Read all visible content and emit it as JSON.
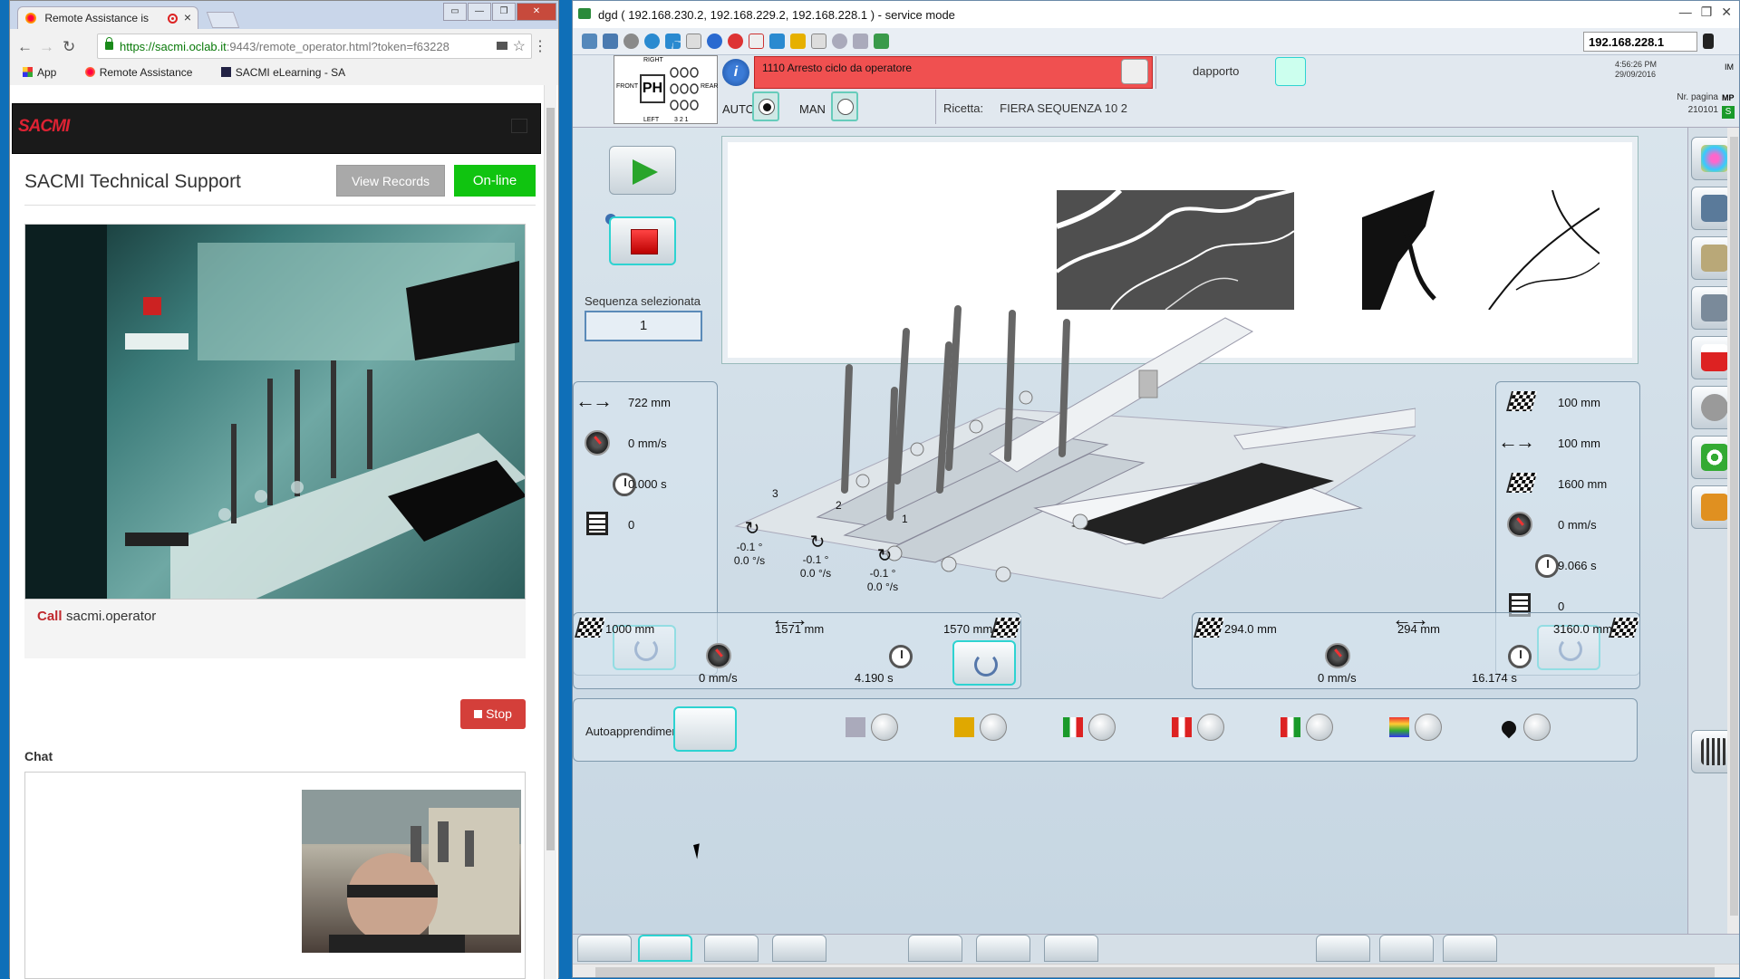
{
  "browser": {
    "tab_title": "Remote Assistance is",
    "url_host": "https://sacmi.oclab.it",
    "url_path": ":9443/remote_operator.html?token=f63228",
    "bookmarks": [
      "App",
      "Remote Assistance",
      "SACMI eLearning - SA"
    ]
  },
  "support": {
    "logo": "SACMI",
    "title": "SACMI Technical Support",
    "view_records": "View Records",
    "online": "On-line",
    "call_label": "Call",
    "call_target": "sacmi.operator",
    "stop": "Stop",
    "chat_label": "Chat"
  },
  "hmi": {
    "window_title": "dgd ( 192.168.230.2, 192.168.229.2, 192.168.228.1 ) - service mode",
    "ip": "192.168.228.1",
    "alarm": "1110 Arresto ciclo da operatore",
    "user": "dapporto",
    "time": "4:56:26 PM",
    "date": "29/09/2016",
    "page_label": "Nr. pagina",
    "page_number": "210101",
    "corner_im": "IM",
    "corner_mp": "MP",
    "corner_s": "S",
    "mode_auto": "AUTO",
    "mode_man": "MAN",
    "recipe_label": "Ricetta:",
    "recipe_value": "FIERA SEQUENZA 10 2",
    "ph_labels": {
      "right": "RIGHT",
      "front": "FRONT",
      "rear": "REAR",
      "left": "LEFT",
      "ph": "PH",
      "nums": "3  2  1"
    },
    "sequence_label": "Sequenza selezionata",
    "sequence_value": "1",
    "left_panel": {
      "distance": "722 mm",
      "speed": "0 mm/s",
      "time": "0.000 s",
      "count": "0"
    },
    "right_panel": {
      "flag1": "100 mm",
      "distance": "100 mm",
      "flag2": "1600 mm",
      "speed": "0 mm/s",
      "time": "9.066 s",
      "count": "0"
    },
    "heads": [
      {
        "num": "3",
        "angle": "-0.1 °",
        "rate": "0.0 °/s"
      },
      {
        "num": "2",
        "angle": "-0.1 °",
        "rate": "0.0 °/s"
      },
      {
        "num": "1",
        "angle": "-0.1 °",
        "rate": "0.0 °/s"
      }
    ],
    "bottom_left": {
      "start": "1000 mm",
      "span": "1571 mm",
      "end": "1570 mm",
      "speed": "0 mm/s",
      "time": "4.190 s"
    },
    "bottom_right": {
      "start": "294.0 mm",
      "span": "294 mm",
      "end": "3160.0 mm",
      "speed": "0 mm/s",
      "time": "16.174 s"
    },
    "auto_label": "Autoapprendimento"
  },
  "colors": {
    "alarm": "#f05050",
    "online": "#10c410",
    "stop": "#d43f3a",
    "accent": "#2ed3d1"
  }
}
